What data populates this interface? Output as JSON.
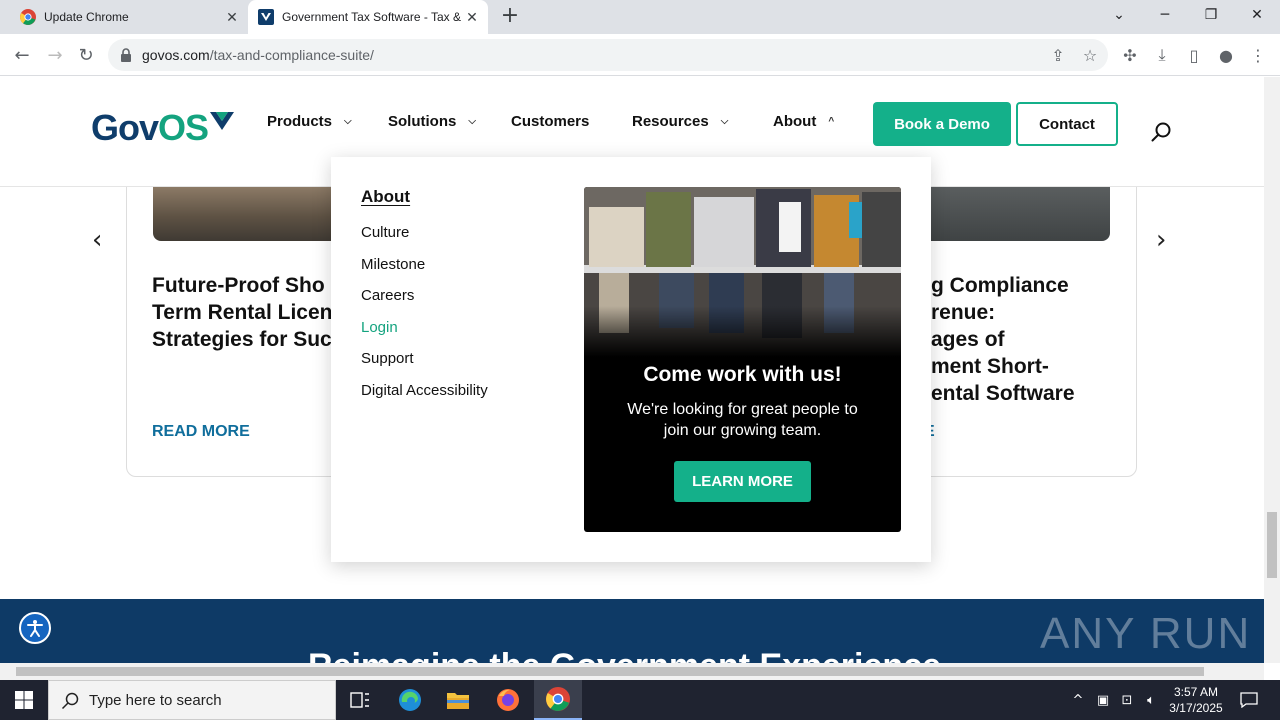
{
  "browser": {
    "tabs": [
      {
        "title": "Update Chrome",
        "icon": "chrome-icon"
      },
      {
        "title": "Government Tax Software - Tax & Compliance Suite",
        "icon": "govos-favicon"
      }
    ],
    "url_host": "govos.com",
    "url_path": "/tax-and-compliance-suite/"
  },
  "site": {
    "logo_gov": "Gov",
    "logo_os": "OS",
    "nav": {
      "products": "Products",
      "solutions": "Solutions",
      "customers": "Customers",
      "resources": "Resources",
      "about": "About"
    },
    "book_demo": "Book a Demo",
    "contact": "Contact"
  },
  "about_menu": {
    "heading": "About",
    "links": [
      "Culture",
      "Milestone",
      "Careers",
      "Login",
      "Support",
      "Digital Accessibility"
    ],
    "active_link": "Login",
    "promo": {
      "title": "Come work with us!",
      "text": "We're looking for great people to join our growing team.",
      "button": "LEARN MORE"
    }
  },
  "carousel": {
    "left_title_lines": [
      "Future-Proof Sho",
      "Term Rental Licen",
      "Strategies for Suc"
    ],
    "right_title_lines": [
      "g Compliance",
      "renue:",
      "ages of",
      "ment Short-",
      "ental Software"
    ],
    "read_more_left": "READ MORE",
    "read_more_right": "E"
  },
  "banner": {
    "title": "Reimagine the Government Experience"
  },
  "watermark": "ANY RUN",
  "taskbar": {
    "search_placeholder": "Type here to search",
    "time": "3:57 AM",
    "date": "3/17/2025"
  },
  "colors": {
    "brand_green": "#14b08a",
    "brand_navy": "#0f3d6b",
    "link_blue": "#106e9c"
  }
}
